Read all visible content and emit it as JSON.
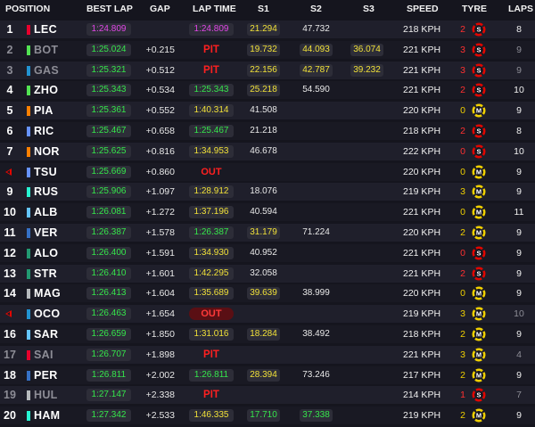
{
  "colors": {
    "purple": "#e046e6",
    "green": "#35e64b",
    "yellow": "#f0e038",
    "pit_red": "#ff2020",
    "tyre_soft": "#e10600",
    "tyre_medium": "#f0d000"
  },
  "headers": {
    "position": "POSITION",
    "best_lap": "BEST LAP",
    "gap": "GAP",
    "lap_time": "LAP TIME",
    "s1": "S1",
    "s2": "S2",
    "s3": "S3",
    "speed": "SPEED",
    "tyre": "TYRE",
    "laps": "LAPS"
  },
  "rows": [
    {
      "pos": "1",
      "driver": "LEC",
      "team_color": "#e8002d",
      "best": "1:24.809",
      "best_color": "purple",
      "gap": "",
      "lap_time": "1:24.809",
      "lt_style": "purple",
      "s1": "21.294",
      "s1_style": "yellow",
      "s2": "47.732",
      "s2_style": "white",
      "s3": "",
      "s3_style": "",
      "speed": "218 KPH",
      "tyre_age": "2",
      "tyre_age_color": "#ff3030",
      "tyre": "S",
      "tyre_icon": "soft-tyre-icon",
      "laps": "8",
      "dim": false,
      "retired": false
    },
    {
      "pos": "2",
      "driver": "BOT",
      "team_color": "#52e252",
      "best": "1:25.024",
      "best_color": "green",
      "gap": "+0.215",
      "lap_time": "PIT",
      "lt_style": "pit",
      "s1": "19.732",
      "s1_style": "yellow",
      "s2": "44.093",
      "s2_style": "yellow",
      "s3": "36.074",
      "s3_style": "yellow",
      "speed": "221 KPH",
      "tyre_age": "3",
      "tyre_age_color": "#ff3030",
      "tyre": "S",
      "tyre_icon": "soft-tyre-icon",
      "laps": "9",
      "dim": true,
      "retired": false
    },
    {
      "pos": "3",
      "driver": "GAS",
      "team_color": "#2293d1",
      "best": "1:25.321",
      "best_color": "green",
      "gap": "+0.512",
      "lap_time": "PIT",
      "lt_style": "pit",
      "s1": "22.156",
      "s1_style": "yellow",
      "s2": "42.787",
      "s2_style": "yellow",
      "s3": "39.232",
      "s3_style": "yellow",
      "speed": "221 KPH",
      "tyre_age": "3",
      "tyre_age_color": "#ff3030",
      "tyre": "S",
      "tyre_icon": "soft-tyre-icon",
      "laps": "9",
      "dim": true,
      "retired": false
    },
    {
      "pos": "4",
      "driver": "ZHO",
      "team_color": "#52e252",
      "best": "1:25.343",
      "best_color": "green",
      "gap": "+0.534",
      "lap_time": "1:25.343",
      "lt_style": "green",
      "s1": "25.218",
      "s1_style": "yellow",
      "s2": "54.590",
      "s2_style": "white",
      "s3": "",
      "s3_style": "",
      "speed": "221 KPH",
      "tyre_age": "2",
      "tyre_age_color": "#ff3030",
      "tyre": "S",
      "tyre_icon": "soft-tyre-icon",
      "laps": "10",
      "dim": false,
      "retired": false
    },
    {
      "pos": "5",
      "driver": "PIA",
      "team_color": "#ff8000",
      "best": "1:25.361",
      "best_color": "green",
      "gap": "+0.552",
      "lap_time": "1:40.314",
      "lt_style": "yellow",
      "s1": "41.508",
      "s1_style": "white",
      "s2": "",
      "s2_style": "",
      "s3": "",
      "s3_style": "",
      "speed": "220 KPH",
      "tyre_age": "0",
      "tyre_age_color": "#f0d000",
      "tyre": "M",
      "tyre_icon": "medium-tyre-icon",
      "laps": "9",
      "dim": false,
      "retired": false
    },
    {
      "pos": "6",
      "driver": "RIC",
      "team_color": "#6692ff",
      "best": "1:25.467",
      "best_color": "green",
      "gap": "+0.658",
      "lap_time": "1:25.467",
      "lt_style": "green",
      "s1": "21.218",
      "s1_style": "white",
      "s2": "",
      "s2_style": "",
      "s3": "",
      "s3_style": "",
      "speed": "218 KPH",
      "tyre_age": "2",
      "tyre_age_color": "#ff3030",
      "tyre": "S",
      "tyre_icon": "soft-tyre-icon",
      "laps": "8",
      "dim": false,
      "retired": false
    },
    {
      "pos": "7",
      "driver": "NOR",
      "team_color": "#ff8000",
      "best": "1:25.625",
      "best_color": "green",
      "gap": "+0.816",
      "lap_time": "1:34.953",
      "lt_style": "yellow",
      "s1": "46.678",
      "s1_style": "white",
      "s2": "",
      "s2_style": "",
      "s3": "",
      "s3_style": "",
      "speed": "222 KPH",
      "tyre_age": "0",
      "tyre_age_color": "#ff3030",
      "tyre": "S",
      "tyre_icon": "soft-tyre-icon",
      "laps": "10",
      "dim": false,
      "retired": false
    },
    {
      "pos": "",
      "driver": "TSU",
      "team_color": "#6692ff",
      "best": "1:25.669",
      "best_color": "green",
      "gap": "+0.860",
      "lap_time": "OUT",
      "lt_style": "out",
      "s1": "",
      "s1_style": "",
      "s2": "",
      "s2_style": "",
      "s3": "",
      "s3_style": "",
      "speed": "220 KPH",
      "tyre_age": "0",
      "tyre_age_color": "#f0d000",
      "tyre": "M",
      "tyre_icon": "medium-tyre-icon",
      "laps": "9",
      "dim": false,
      "retired": true
    },
    {
      "pos": "9",
      "driver": "RUS",
      "team_color": "#27f4d2",
      "best": "1:25.906",
      "best_color": "green",
      "gap": "+1.097",
      "lap_time": "1:28.912",
      "lt_style": "yellow",
      "s1": "18.076",
      "s1_style": "white",
      "s2": "",
      "s2_style": "",
      "s3": "",
      "s3_style": "",
      "speed": "219 KPH",
      "tyre_age": "3",
      "tyre_age_color": "#f0d000",
      "tyre": "M",
      "tyre_icon": "medium-tyre-icon",
      "laps": "9",
      "dim": false,
      "retired": false
    },
    {
      "pos": "10",
      "driver": "ALB",
      "team_color": "#64c4ff",
      "best": "1:26.081",
      "best_color": "green",
      "gap": "+1.272",
      "lap_time": "1:37.196",
      "lt_style": "yellow",
      "s1": "40.594",
      "s1_style": "white",
      "s2": "",
      "s2_style": "",
      "s3": "",
      "s3_style": "",
      "speed": "221 KPH",
      "tyre_age": "0",
      "tyre_age_color": "#f0d000",
      "tyre": "M",
      "tyre_icon": "medium-tyre-icon",
      "laps": "11",
      "dim": false,
      "retired": false
    },
    {
      "pos": "11",
      "driver": "VER",
      "team_color": "#3671c6",
      "best": "1:26.387",
      "best_color": "green",
      "gap": "+1.578",
      "lap_time": "1:26.387",
      "lt_style": "green",
      "s1": "31.179",
      "s1_style": "yellow",
      "s2": "71.224",
      "s2_style": "white",
      "s3": "",
      "s3_style": "",
      "speed": "220 KPH",
      "tyre_age": "2",
      "tyre_age_color": "#f0d000",
      "tyre": "M",
      "tyre_icon": "medium-tyre-icon",
      "laps": "9",
      "dim": false,
      "retired": false
    },
    {
      "pos": "12",
      "driver": "ALO",
      "team_color": "#229971",
      "best": "1:26.400",
      "best_color": "green",
      "gap": "+1.591",
      "lap_time": "1:34.930",
      "lt_style": "yellow",
      "s1": "40.952",
      "s1_style": "white",
      "s2": "",
      "s2_style": "",
      "s3": "",
      "s3_style": "",
      "speed": "221 KPH",
      "tyre_age": "0",
      "tyre_age_color": "#ff3030",
      "tyre": "S",
      "tyre_icon": "soft-tyre-icon",
      "laps": "9",
      "dim": false,
      "retired": false
    },
    {
      "pos": "13",
      "driver": "STR",
      "team_color": "#229971",
      "best": "1:26.410",
      "best_color": "green",
      "gap": "+1.601",
      "lap_time": "1:42.295",
      "lt_style": "yellow",
      "s1": "32.058",
      "s1_style": "white",
      "s2": "",
      "s2_style": "",
      "s3": "",
      "s3_style": "",
      "speed": "221 KPH",
      "tyre_age": "2",
      "tyre_age_color": "#ff3030",
      "tyre": "S",
      "tyre_icon": "soft-tyre-icon",
      "laps": "9",
      "dim": false,
      "retired": false
    },
    {
      "pos": "14",
      "driver": "MAG",
      "team_color": "#b6babd",
      "best": "1:26.413",
      "best_color": "green",
      "gap": "+1.604",
      "lap_time": "1:35.689",
      "lt_style": "yellow",
      "s1": "39.639",
      "s1_style": "yellow",
      "s2": "38.999",
      "s2_style": "white",
      "s3": "",
      "s3_style": "",
      "speed": "220 KPH",
      "tyre_age": "0",
      "tyre_age_color": "#f0d000",
      "tyre": "M",
      "tyre_icon": "medium-tyre-icon",
      "laps": "9",
      "dim": false,
      "retired": false
    },
    {
      "pos": "",
      "driver": "OCO",
      "team_color": "#2293d1",
      "best": "1:26.463",
      "best_color": "green",
      "gap": "+1.654",
      "lap_time": "OUT",
      "lt_style": "outbox",
      "s1": "",
      "s1_style": "",
      "s2": "",
      "s2_style": "",
      "s3": "",
      "s3_style": "",
      "speed": "219 KPH",
      "tyre_age": "3",
      "tyre_age_color": "#f0d000",
      "tyre": "M",
      "tyre_icon": "medium-tyre-icon",
      "laps": "10",
      "dim": false,
      "retired": true,
      "laps_dim": true
    },
    {
      "pos": "16",
      "driver": "SAR",
      "team_color": "#64c4ff",
      "best": "1:26.659",
      "best_color": "green",
      "gap": "+1.850",
      "lap_time": "1:31.016",
      "lt_style": "yellow",
      "s1": "18.284",
      "s1_style": "yellow",
      "s2": "38.492",
      "s2_style": "white",
      "s3": "",
      "s3_style": "",
      "speed": "218 KPH",
      "tyre_age": "2",
      "tyre_age_color": "#f0d000",
      "tyre": "M",
      "tyre_icon": "medium-tyre-icon",
      "laps": "9",
      "dim": false,
      "retired": false
    },
    {
      "pos": "17",
      "driver": "SAI",
      "team_color": "#e8002d",
      "best": "1:26.707",
      "best_color": "green",
      "gap": "+1.898",
      "lap_time": "PIT",
      "lt_style": "pit",
      "s1": "",
      "s1_style": "",
      "s2": "",
      "s2_style": "",
      "s3": "",
      "s3_style": "",
      "speed": "221 KPH",
      "tyre_age": "3",
      "tyre_age_color": "#f0d000",
      "tyre": "M",
      "tyre_icon": "medium-tyre-icon",
      "laps": "4",
      "dim": true,
      "retired": false
    },
    {
      "pos": "18",
      "driver": "PER",
      "team_color": "#3671c6",
      "best": "1:26.811",
      "best_color": "green",
      "gap": "+2.002",
      "lap_time": "1:26.811",
      "lt_style": "green",
      "s1": "28.394",
      "s1_style": "yellow",
      "s2": "73.246",
      "s2_style": "white",
      "s3": "",
      "s3_style": "",
      "speed": "217 KPH",
      "tyre_age": "2",
      "tyre_age_color": "#f0d000",
      "tyre": "M",
      "tyre_icon": "medium-tyre-icon",
      "laps": "9",
      "dim": false,
      "retired": false
    },
    {
      "pos": "19",
      "driver": "HUL",
      "team_color": "#b6babd",
      "best": "1:27.147",
      "best_color": "green",
      "gap": "+2.338",
      "lap_time": "PIT",
      "lt_style": "pit",
      "s1": "",
      "s1_style": "",
      "s2": "",
      "s2_style": "",
      "s3": "",
      "s3_style": "",
      "speed": "214 KPH",
      "tyre_age": "1",
      "tyre_age_color": "#ff3030",
      "tyre": "S",
      "tyre_icon": "soft-tyre-icon",
      "laps": "7",
      "dim": true,
      "retired": false
    },
    {
      "pos": "20",
      "driver": "HAM",
      "team_color": "#27f4d2",
      "best": "1:27.342",
      "best_color": "green",
      "gap": "+2.533",
      "lap_time": "1:46.335",
      "lt_style": "yellow",
      "s1": "17.710",
      "s1_style": "green",
      "s2": "37.338",
      "s2_style": "green",
      "s3": "",
      "s3_style": "",
      "speed": "219 KPH",
      "tyre_age": "2",
      "tyre_age_color": "#f0d000",
      "tyre": "M",
      "tyre_icon": "medium-tyre-icon",
      "laps": "9",
      "dim": false,
      "retired": false
    }
  ]
}
